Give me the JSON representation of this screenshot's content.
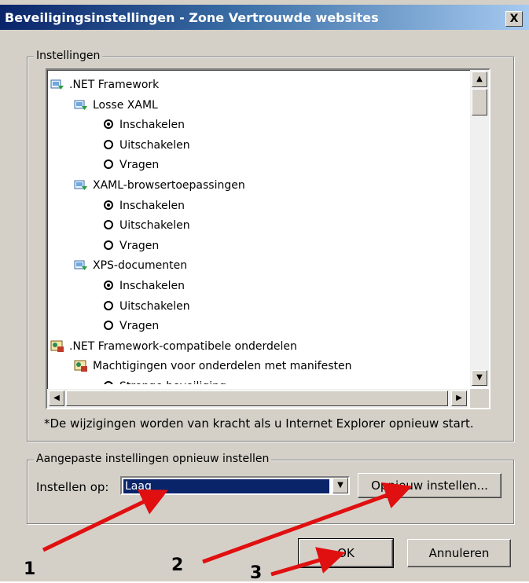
{
  "window": {
    "title": "Beveiligingsinstellingen - Zone Vertrouwde websites",
    "close_label": "X"
  },
  "settings_group": {
    "label": "Instellingen",
    "items": [
      {
        "kind": "folder",
        "label": ".NET Framework",
        "icon": "net-settings-icon"
      },
      {
        "kind": "folder",
        "label": "Losse XAML",
        "icon": "net-settings-icon"
      },
      {
        "kind": "option",
        "label": "Inschakelen",
        "selected": true
      },
      {
        "kind": "option",
        "label": "Uitschakelen",
        "selected": false
      },
      {
        "kind": "option",
        "label": "Vragen",
        "selected": false
      },
      {
        "kind": "folder",
        "label": "XAML-browsertoepassingen",
        "icon": "net-settings-icon"
      },
      {
        "kind": "option",
        "label": "Inschakelen",
        "selected": true
      },
      {
        "kind": "option",
        "label": "Uitschakelen",
        "selected": false
      },
      {
        "kind": "option",
        "label": "Vragen",
        "selected": false
      },
      {
        "kind": "folder",
        "label": "XPS-documenten",
        "icon": "net-settings-icon"
      },
      {
        "kind": "option",
        "label": "Inschakelen",
        "selected": true
      },
      {
        "kind": "option",
        "label": "Uitschakelen",
        "selected": false
      },
      {
        "kind": "option",
        "label": "Vragen",
        "selected": false
      },
      {
        "kind": "folder",
        "label": ".NET Framework-compatibele onderdelen",
        "icon": "certificate-icon"
      },
      {
        "kind": "folder",
        "label": "Machtigingen voor onderdelen met manifesten",
        "icon": "certificate-icon"
      },
      {
        "kind": "option",
        "label": "Strenge beveiliging",
        "selected": true
      }
    ],
    "note": "*De wijzigingen worden van kracht als u Internet Explorer opnieuw start."
  },
  "reset_group": {
    "label": "Aangepaste instellingen opnieuw instellen",
    "set_to_label": "Instellen op:",
    "level_value": "Laag",
    "reset_button": "Opnieuw instellen..."
  },
  "buttons": {
    "ok": "OK",
    "cancel": "Annuleren"
  },
  "annotations": {
    "marker_1": "1",
    "marker_2": "2",
    "marker_3": "3",
    "arrow_color": "#e01010"
  }
}
